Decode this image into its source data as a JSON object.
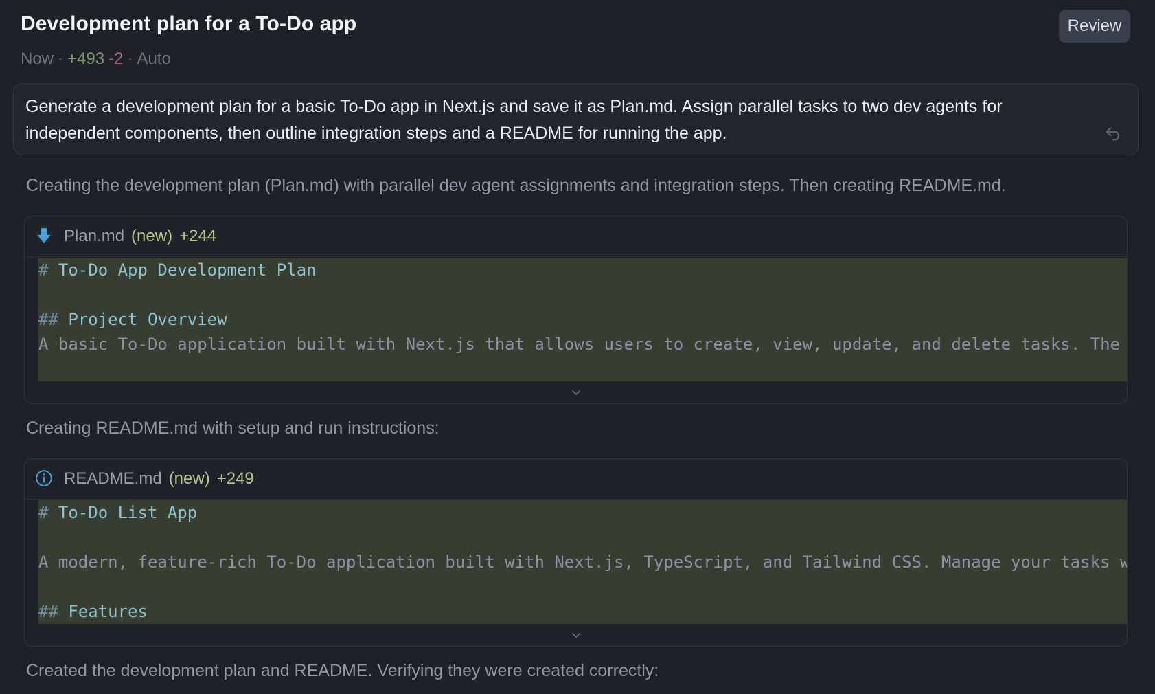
{
  "header": {
    "title": "Development plan for a To-Do app",
    "time": "Now",
    "additions": "+493",
    "deletions": "-2",
    "mode": "Auto",
    "review_label": "Review"
  },
  "prompt": {
    "text": "Generate a development plan for a basic To-Do app in Next.js and save it as Plan.md. Assign parallel tasks to two dev agents for independent components, then outline integration steps and a README for running the app.",
    "undo_icon": "undo-icon"
  },
  "messages": {
    "first": "Creating the development plan (Plan.md) with parallel dev agent assignments and integration steps. Then creating README.md.",
    "second": "Creating README.md with setup and run instructions:",
    "third": "Created the development plan and README. Verifying they were created correctly:"
  },
  "files": [
    {
      "name": "Plan.md",
      "status": "(new)",
      "additions": "+244",
      "icon": "download-arrow-icon",
      "lines": [
        {
          "hash": "# ",
          "text": "To-Do App Development Plan",
          "kind": "heading"
        },
        {
          "hash": "",
          "text": "",
          "kind": "blank"
        },
        {
          "hash": "## ",
          "text": "Project Overview",
          "kind": "heading"
        },
        {
          "hash": "",
          "text": "A basic To-Do application built with Next.js that allows users to create, view, update, and delete tasks. The",
          "kind": "body"
        }
      ]
    },
    {
      "name": "README.md",
      "status": "(new)",
      "additions": "+249",
      "icon": "info-icon",
      "lines": [
        {
          "hash": "# ",
          "text": "To-Do List App",
          "kind": "heading"
        },
        {
          "hash": "",
          "text": "",
          "kind": "blank"
        },
        {
          "hash": "",
          "text": "A modern, feature-rich To-Do application built with Next.js, TypeScript, and Tailwind CSS. Manage your tasks w",
          "kind": "body"
        },
        {
          "hash": "",
          "text": "",
          "kind": "blank"
        },
        {
          "hash": "## ",
          "text": "Features",
          "kind": "heading"
        }
      ]
    }
  ],
  "colors": {
    "background": "#1f2129",
    "diff_added_bg": "#383d31",
    "plus": "#7e9a6d",
    "minus": "#b0616a",
    "new_badge": "#b5c88c"
  }
}
